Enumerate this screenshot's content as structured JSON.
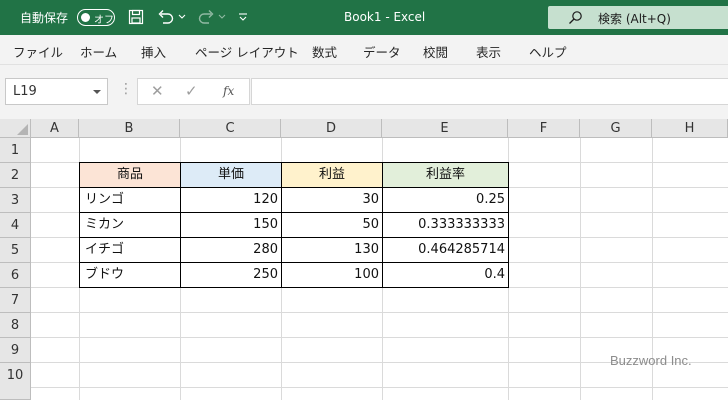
{
  "titlebar": {
    "autosave_label": "自動保存",
    "autosave_state": "オフ",
    "title": "Book1  -  Excel",
    "search_label": "検索 (Alt+Q)",
    "bg_color": "#217346"
  },
  "ribbon": {
    "tabs": [
      "ファイル",
      "ホーム",
      "挿入",
      "ページ レイアウト",
      "数式",
      "データ",
      "校閲",
      "表示",
      "ヘルプ"
    ]
  },
  "formula_bar": {
    "name_box": "L19",
    "fx_label": "fx",
    "content": ""
  },
  "grid": {
    "columns": [
      "A",
      "B",
      "C",
      "D",
      "E",
      "F",
      "G",
      "H"
    ],
    "rows": [
      "1",
      "2",
      "3",
      "4",
      "5",
      "6",
      "7",
      "8",
      "9",
      "10"
    ],
    "table": {
      "headers": [
        {
          "text": "商品",
          "color": "#fce4d6"
        },
        {
          "text": "単価",
          "color": "#ddebf7"
        },
        {
          "text": "利益",
          "color": "#fff2cc"
        },
        {
          "text": "利益率",
          "color": "#e2efda"
        }
      ],
      "rows": [
        [
          "リンゴ",
          "120",
          "30",
          "0.25"
        ],
        [
          "ミカン",
          "150",
          "50",
          "0.333333333"
        ],
        [
          "イチゴ",
          "280",
          "130",
          "0.464285714"
        ],
        [
          "ブドウ",
          "250",
          "100",
          "0.4"
        ]
      ]
    }
  },
  "watermark": "Buzzword Inc."
}
